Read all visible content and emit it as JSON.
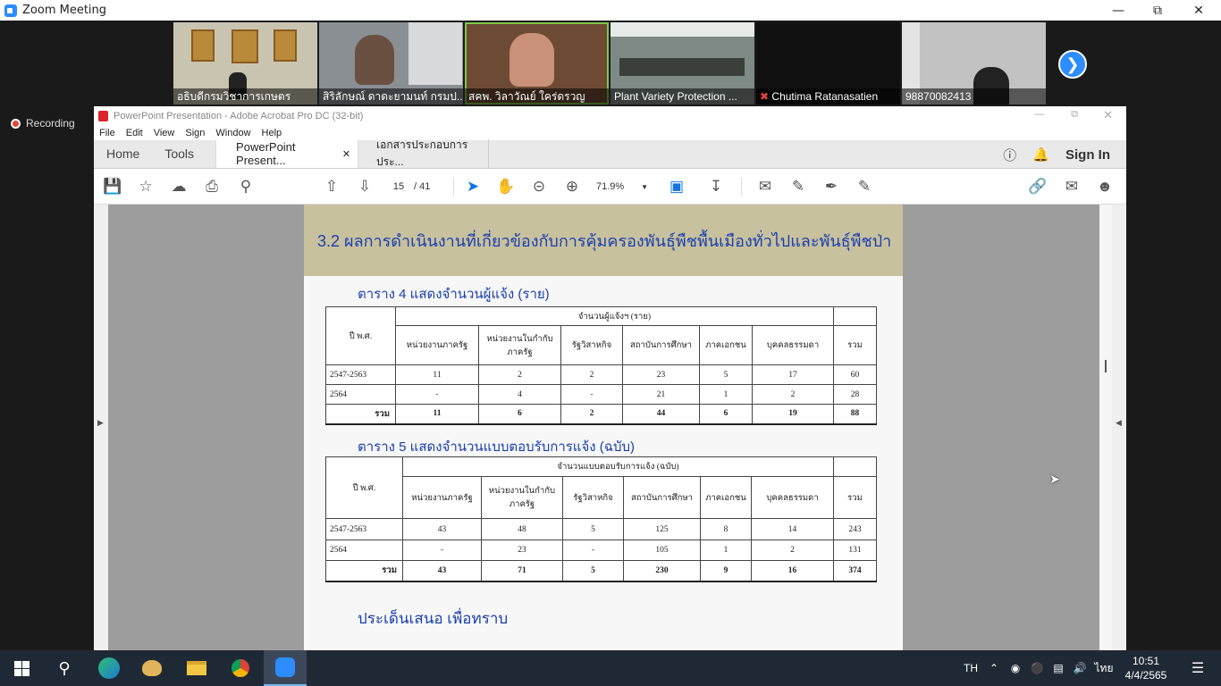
{
  "zoom": {
    "window_title": "Zoom Meeting",
    "recording_label": "Recording",
    "participants": [
      {
        "name": "อธิบดีกรมวิชาการเกษตร"
      },
      {
        "name": "สิริลักษณ์ ดาดะยามนท์ กรมป..."
      },
      {
        "name": "สคพ. วิลาวัณย์ ใคร่ดรวญ"
      },
      {
        "name": "Plant Variety Protection ..."
      },
      {
        "name": "Chutima Ratanasatien"
      },
      {
        "name": "98870082413"
      }
    ]
  },
  "acrobat": {
    "title": "PowerPoint Presentation - Adobe Acrobat Pro DC (32-bit)",
    "menu": [
      "File",
      "Edit",
      "View",
      "Sign",
      "Window",
      "Help"
    ],
    "tabs": {
      "home": "Home",
      "tools": "Tools",
      "doc1": "PowerPoint Present...",
      "doc2": "เอกสารประกอบการประ..."
    },
    "sign_in": "Sign In",
    "page_current": "15",
    "page_total": "/  41",
    "zoom": "71.9%"
  },
  "slide": {
    "heading": "3.2 ผลการดำเนินงานที่เกี่ยวข้องกับการคุ้มครองพันธุ์พืชพื้นเมืองทั่วไปและพันธุ์พืชป่า",
    "table4": {
      "caption": "ตาราง 4  แสดงจำนวนผู้แจ้ง (ราย)",
      "year_header": "ปี พ.ศ.",
      "group_header": "จำนวนผู้แจ้งฯ (ราย)",
      "columns": [
        "หน่วยงานภาครัฐ",
        "หน่วยงานในกำกับภาครัฐ",
        "รัฐวิสาหกิจ",
        "สถาบันการศึกษา",
        "ภาคเอกชน",
        "บุคคลธรรมดา",
        "รวม"
      ],
      "rows": [
        {
          "year": "2547-2563",
          "vals": [
            "11",
            "2",
            "2",
            "23",
            "5",
            "17",
            "60"
          ]
        },
        {
          "year": "2564",
          "vals": [
            "-",
            "4",
            "-",
            "21",
            "1",
            "2",
            "28"
          ]
        }
      ],
      "total": {
        "label": "รวม",
        "vals": [
          "11",
          "6",
          "2",
          "44",
          "6",
          "19",
          "88"
        ]
      }
    },
    "table5": {
      "caption": "ตาราง 5  แสดงจำนวนแบบตอบรับการแจ้ง (ฉบับ)",
      "year_header": "ปี พ.ศ.",
      "group_header": "จำนวนแบบตอบรับการแจ้ง (ฉบับ)",
      "columns": [
        "หน่วยงานภาครัฐ",
        "หน่วยงานในกำกับภาครัฐ",
        "รัฐวิสาหกิจ",
        "สถาบันการศึกษา",
        "ภาคเอกชน",
        "บุคคลธรรมดา",
        "รวม"
      ],
      "rows": [
        {
          "year": "2547-2563",
          "vals": [
            "43",
            "48",
            "5",
            "125",
            "8",
            "14",
            "243"
          ]
        },
        {
          "year": "2564",
          "vals": [
            "-",
            "23",
            "-",
            "105",
            "1",
            "2",
            "131"
          ]
        }
      ],
      "total": {
        "label": "รวม",
        "vals": [
          "43",
          "71",
          "5",
          "230",
          "9",
          "16",
          "374"
        ]
      }
    },
    "proposal": "ประเด็นเสนอ    เพื่อทราบ"
  },
  "taskbar": {
    "lang": "TH",
    "ime": "ไทย",
    "time": "10:51",
    "date": "4/4/2565"
  }
}
